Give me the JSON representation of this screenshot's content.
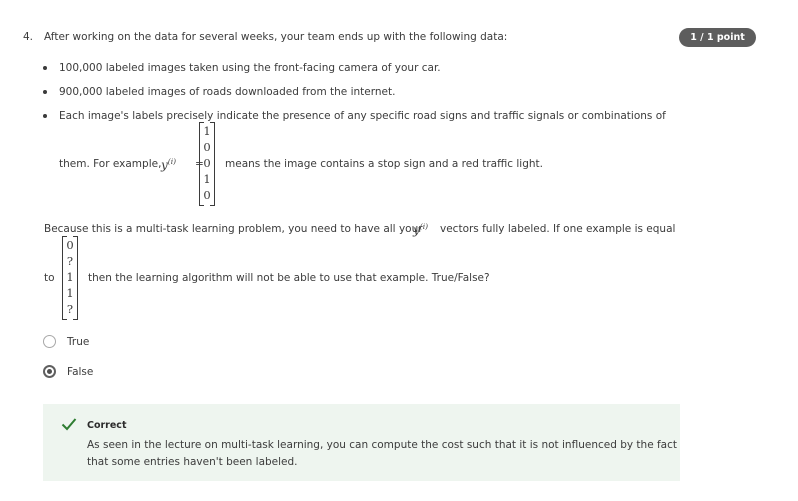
{
  "question": {
    "number": "4.",
    "text": "After working on the data for several weeks, your team ends up with the following data:",
    "score": "1 / 1 point",
    "bullets": [
      "100,000 labeled images taken using the front-facing camera of your car.",
      "900,000 labeled images of roads downloaded from the internet.",
      "Each image's labels precisely indicate the presence of any specific road signs and traffic signals or combinations of"
    ],
    "example": {
      "lead": "them. For example,",
      "var": "y",
      "sup": "(i)",
      "eq": "=",
      "vector": [
        "1",
        "0",
        "0",
        "1",
        "0"
      ],
      "tail": "means the image contains a stop sign and a red traffic light."
    },
    "multitask": {
      "part1": "Because this is a multi-task learning problem, you need to have all your",
      "var": "y",
      "sup": "(i)",
      "part2": "vectors fully labeled. If one example is equal",
      "to": "to",
      "vector": [
        "0",
        "?",
        "1",
        "1",
        "?"
      ],
      "tail": "then the learning algorithm will not be able to use that example. True/False?"
    },
    "options": [
      {
        "label": "True",
        "selected": false
      },
      {
        "label": "False",
        "selected": true
      }
    ]
  },
  "feedback": {
    "status": "Correct",
    "icon": "check-icon",
    "line1": "As seen in the lecture on multi-task learning, you can compute the cost such that it is not influenced by the fact",
    "line2": "that some entries haven't been labeled.",
    "color": "#2e7d32"
  }
}
